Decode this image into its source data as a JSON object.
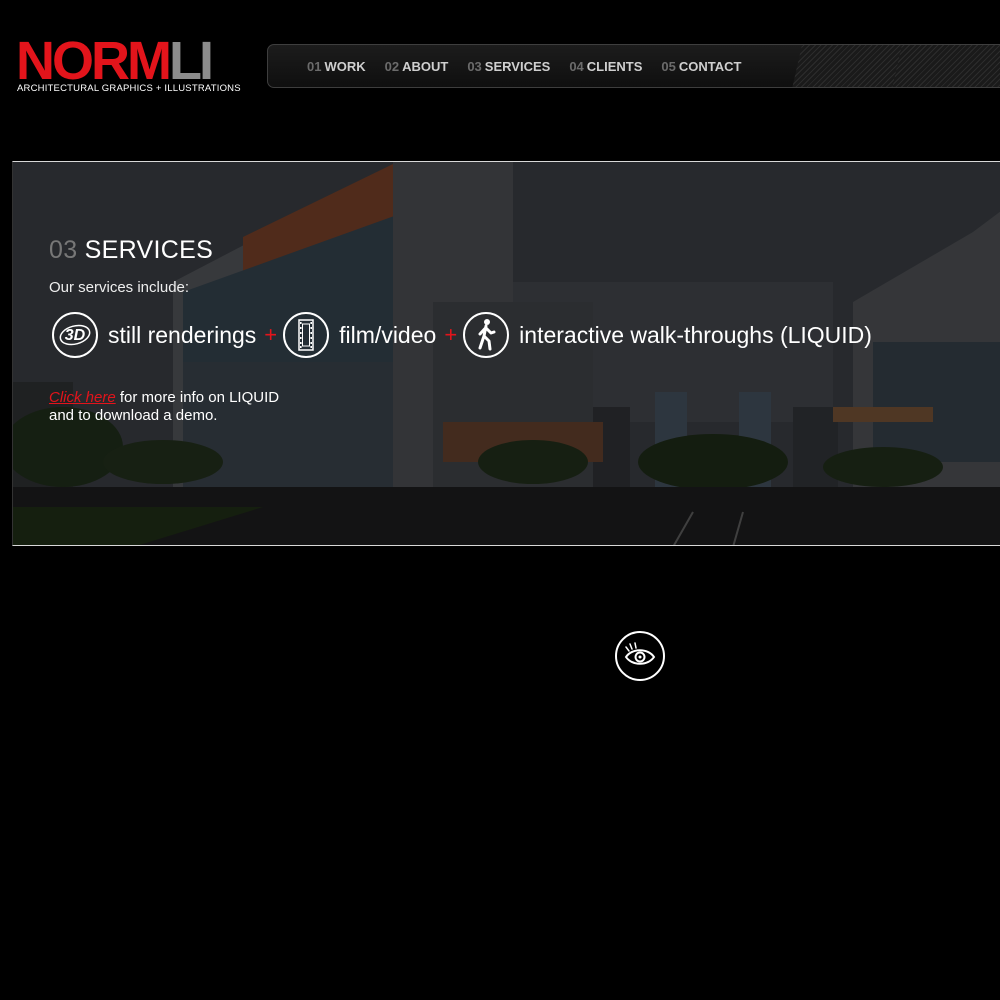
{
  "brand": {
    "name_red": "NORM",
    "name_grey": "LI",
    "tagline": "ARCHITECTURAL GRAPHICS + ILLUSTRATIONS"
  },
  "nav": {
    "items": [
      {
        "num": "01",
        "label": "WORK"
      },
      {
        "num": "02",
        "label": "ABOUT"
      },
      {
        "num": "03",
        "label": "SERVICES"
      },
      {
        "num": "04",
        "label": "CLIENTS"
      },
      {
        "num": "05",
        "label": "CONTACT"
      }
    ]
  },
  "hero": {
    "section_num": "03",
    "section_title": "SERVICES",
    "intro": "Our services include:",
    "services": [
      {
        "icon": "3d-icon",
        "icon_text": "3D",
        "label": "still renderings"
      },
      {
        "icon": "film-icon",
        "label": "film/video"
      },
      {
        "icon": "walker-icon",
        "label": "interactive walk-throughs (LIQUID)"
      }
    ],
    "separator": "+",
    "link_label": "Click here",
    "link_suffix": " for more info on LIQUID",
    "link_line2": "and to download a demo."
  },
  "footer": {
    "icon": "eye-icon"
  },
  "colors": {
    "accent": "#e3141b",
    "background": "#000000",
    "nav_number": "#6b6b6b"
  }
}
